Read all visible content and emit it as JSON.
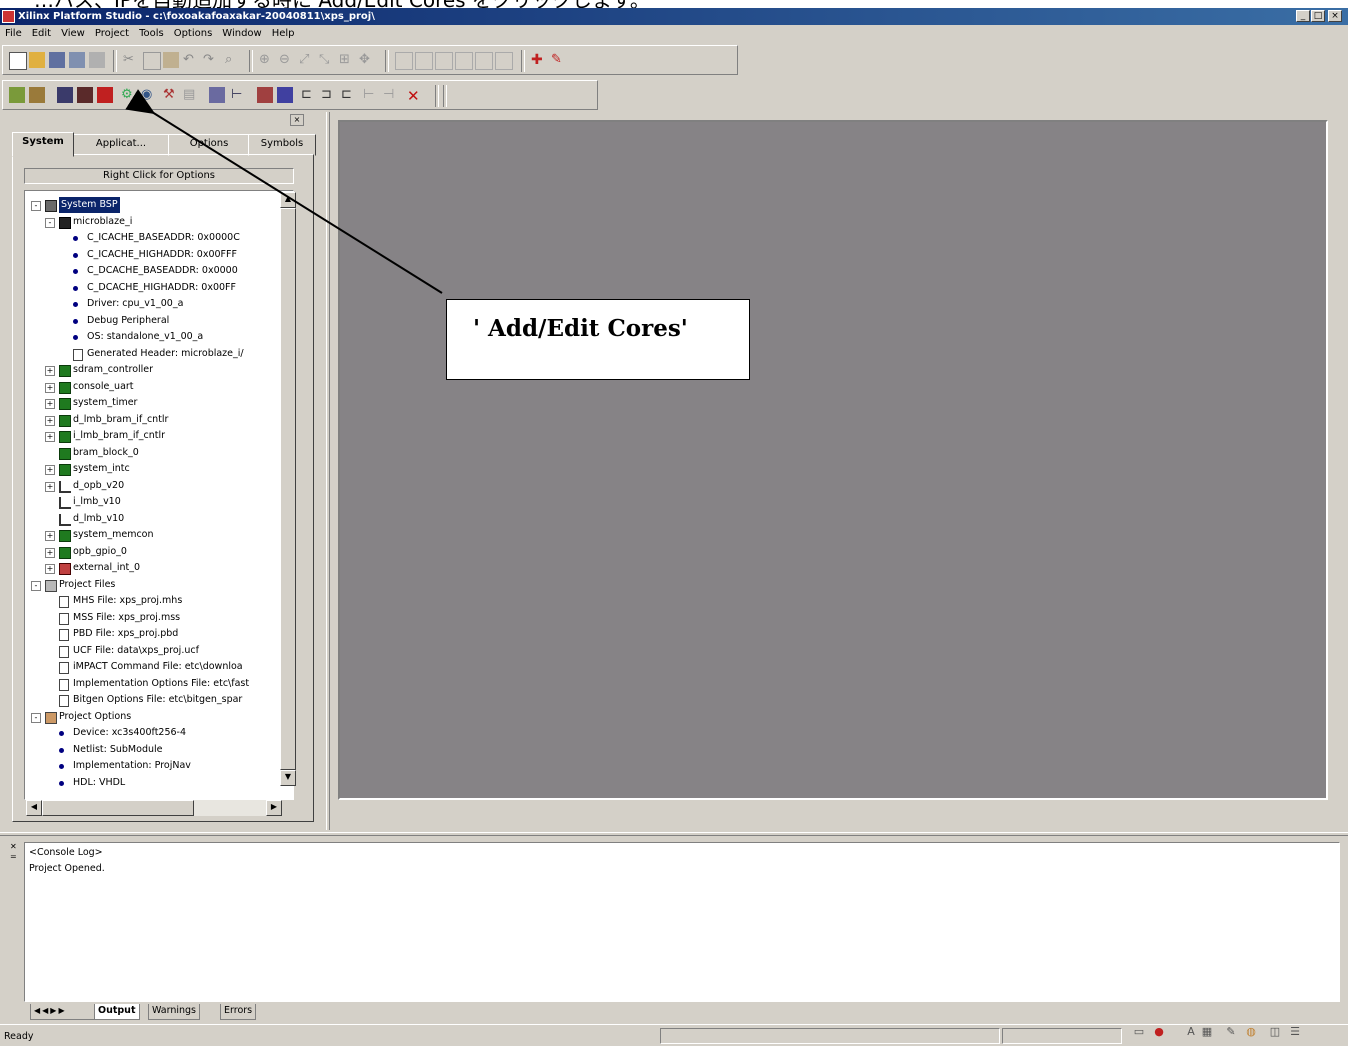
{
  "caption": "…バス、IPを自動追加する時に Add/Edit Cores をクリックします。",
  "window": {
    "title": "Xilinx Platform Studio - c:\\foxoakafoaxakar-20040811\\xps_proj\\",
    "controls": [
      "_",
      "□",
      "×"
    ]
  },
  "menu": [
    "File",
    "Edit",
    "View",
    "Project",
    "Tools",
    "Options",
    "Window",
    "Help"
  ],
  "left_tabs": [
    "System",
    "Applicat...",
    "Options",
    "Symbols"
  ],
  "right_click_label": "Right Click for Options",
  "tree": [
    {
      "label": "System BSP",
      "icon": "system-icon",
      "level": 0,
      "expander": "-",
      "selected": true
    },
    {
      "label": "microblaze_i",
      "icon": "cpu-icon",
      "level": 1,
      "expander": "-"
    },
    {
      "label": "C_ICACHE_BASEADDR: 0x0000C",
      "icon": "parameter-bullet-icon",
      "level": 2
    },
    {
      "label": "C_ICACHE_HIGHADDR: 0x00FFF",
      "icon": "parameter-bullet-icon",
      "level": 2
    },
    {
      "label": "C_DCACHE_BASEADDR: 0x0000",
      "icon": "parameter-bullet-icon",
      "level": 2
    },
    {
      "label": "C_DCACHE_HIGHADDR: 0x00FF",
      "icon": "parameter-bullet-icon",
      "level": 2
    },
    {
      "label": "Driver: cpu_v1_00_a",
      "icon": "parameter-bullet-icon",
      "level": 2
    },
    {
      "label": "Debug Peripheral",
      "icon": "parameter-bullet-icon",
      "level": 2
    },
    {
      "label": "OS: standalone_v1_00_a",
      "icon": "parameter-bullet-icon",
      "level": 2
    },
    {
      "label": "Generated Header: microblaze_i/",
      "icon": "file-icon",
      "level": 2
    },
    {
      "label": "sdram_controller",
      "icon": "core-icon",
      "level": 1,
      "expander": "+"
    },
    {
      "label": "console_uart",
      "icon": "core-icon",
      "level": 1,
      "expander": "+"
    },
    {
      "label": "system_timer",
      "icon": "core-icon",
      "level": 1,
      "expander": "+"
    },
    {
      "label": "d_lmb_bram_if_cntlr",
      "icon": "core-icon",
      "level": 1,
      "expander": "+"
    },
    {
      "label": "i_lmb_bram_if_cntlr",
      "icon": "core-icon",
      "level": 1,
      "expander": "+"
    },
    {
      "label": "bram_block_0",
      "icon": "core-icon",
      "level": 1
    },
    {
      "label": "system_intc",
      "icon": "core-icon",
      "level": 1,
      "expander": "+"
    },
    {
      "label": "d_opb_v20",
      "icon": "bus-icon",
      "level": 1,
      "expander": "+"
    },
    {
      "label": "i_lmb_v10",
      "icon": "bus-icon",
      "level": 1
    },
    {
      "label": "d_lmb_v10",
      "icon": "bus-icon",
      "level": 1
    },
    {
      "label": "system_memcon",
      "icon": "core-icon",
      "level": 1,
      "expander": "+"
    },
    {
      "label": "opb_gpio_0",
      "icon": "core-icon",
      "level": 1,
      "expander": "+"
    },
    {
      "label": "external_int_0",
      "icon": "external-port-icon",
      "level": 1,
      "expander": "+"
    },
    {
      "label": "Project Files",
      "icon": "project-files-icon",
      "level": 0,
      "expander": "-"
    },
    {
      "label": "MHS File: xps_proj.mhs",
      "icon": "file-icon",
      "level": 1
    },
    {
      "label": "MSS File: xps_proj.mss",
      "icon": "file-icon",
      "level": 1
    },
    {
      "label": "PBD File: xps_proj.pbd",
      "icon": "file-icon",
      "level": 1
    },
    {
      "label": "UCF File: data\\xps_proj.ucf",
      "icon": "file-icon",
      "level": 1
    },
    {
      "label": "iMPACT Command File: etc\\downloa",
      "icon": "file-icon",
      "level": 1
    },
    {
      "label": "Implementation Options File: etc\\fast",
      "icon": "file-icon",
      "level": 1
    },
    {
      "label": "Bitgen Options File: etc\\bitgen_spar",
      "icon": "file-icon",
      "level": 1
    },
    {
      "label": "Project Options",
      "icon": "project-options-icon",
      "level": 0,
      "expander": "-"
    },
    {
      "label": "Device: xc3s400ft256-4",
      "icon": "parameter-bullet-icon",
      "level": 1
    },
    {
      "label": "Netlist: SubModule",
      "icon": "parameter-bullet-icon",
      "level": 1
    },
    {
      "label": "Implementation: ProjNav",
      "icon": "parameter-bullet-icon",
      "level": 1
    },
    {
      "label": "HDL: VHDL",
      "icon": "parameter-bullet-icon",
      "level": 1
    }
  ],
  "annotation": {
    "text": "' Add/Edit Cores'"
  },
  "console": {
    "lines": [
      "<Console Log>",
      "Project Opened."
    ]
  },
  "bottom_tabs": [
    "Output",
    "Warnings",
    "Errors"
  ],
  "status": {
    "text": "Ready"
  },
  "colors": {
    "workarea": "#868386",
    "chrome": "#d4d0c8",
    "titlebar": "#0a246a",
    "selection": "#0a246a"
  }
}
